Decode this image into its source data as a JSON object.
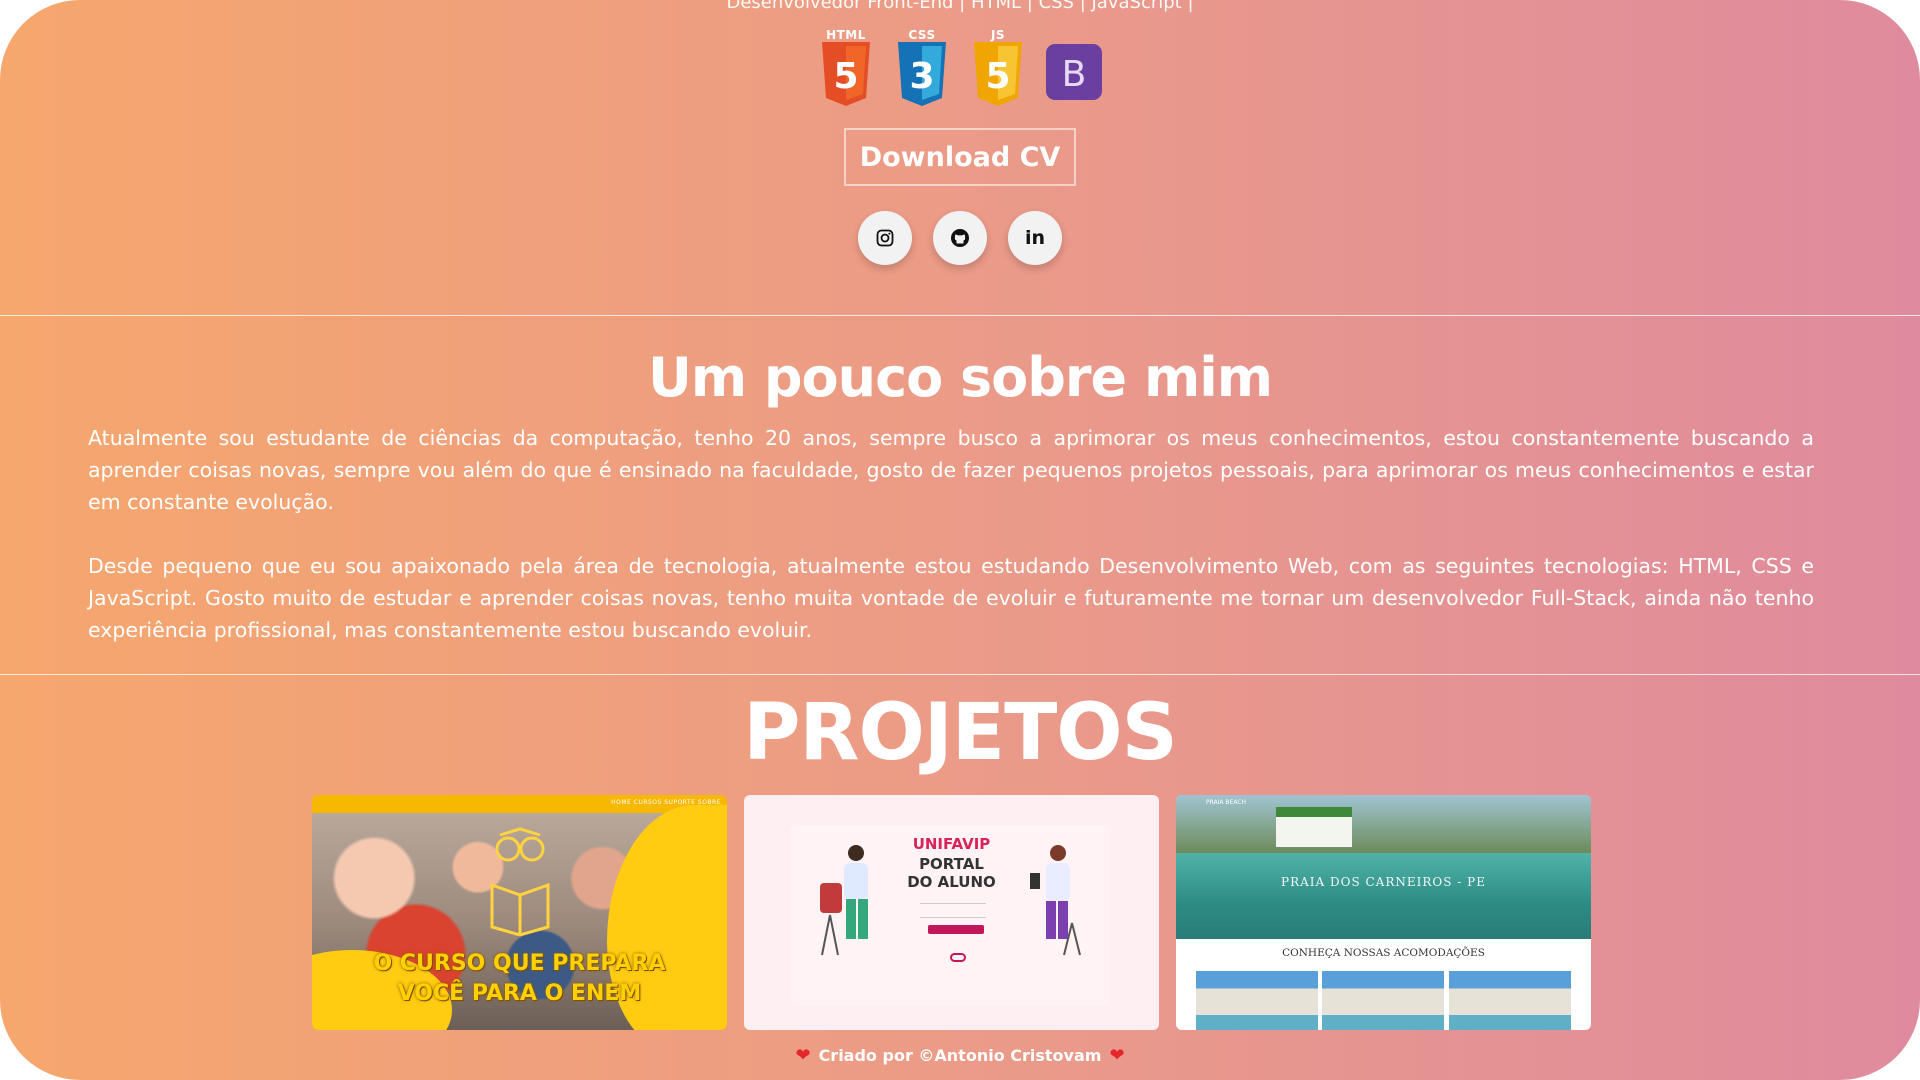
{
  "header": {
    "subtitle": "Desenvolvedor Front-End | HTML | CSS | JavaScript |"
  },
  "tech_icons": [
    {
      "icon": "html5-icon",
      "label": "HTML",
      "glyph": "5",
      "color": "#e44d26"
    },
    {
      "icon": "css3-icon",
      "label": "CSS",
      "glyph": "3",
      "color": "#1572b6"
    },
    {
      "icon": "javascript-icon",
      "label": "JS",
      "glyph": "5",
      "color": "#f5b800"
    },
    {
      "icon": "bootstrap-icon",
      "label": "",
      "glyph": "B",
      "color": "#6b3fa0"
    }
  ],
  "download_label": "Download CV",
  "social": [
    {
      "icon": "instagram-icon"
    },
    {
      "icon": "github-icon"
    },
    {
      "icon": "linkedin-icon",
      "text": "in"
    }
  ],
  "about": {
    "title": "Um pouco sobre mim",
    "paragraph1": "Atualmente sou estudante de ciências da computação, tenho 20 anos, sempre busco a aprimorar os meus conhecimentos, estou constantemente buscando a aprender coisas novas, sempre vou além do que é ensinado na faculdade, gosto de fazer pequenos projetos pessoais, para aprimorar os meus conhecimentos e estar em constante evolução.",
    "paragraph2": "Desde pequeno que eu sou apaixonado pela área de tecnologia, atualmente estou estudando Desenvolvimento Web, com as seguintes tecnologias: HTML, CSS e JavaScript. Gosto muito de estudar e aprender coisas novas, tenho muita vontade de evoluir e futuramente me tornar um desenvolvedor Full-Stack, ainda não tenho experiência profissional, mas constantemente estou buscando evoluir."
  },
  "projects": {
    "title": "PROJETOS",
    "items": [
      {
        "name": "enem-course",
        "nav": "HOME  CURSOS  SUPORTE  SOBRE",
        "headline_line1": "O CURSO QUE PREPARA",
        "headline_line2": "VOCÊ PARA O ENEM"
      },
      {
        "name": "portal-aluno",
        "brand": "UNIFAVIP",
        "line1": "PORTAL",
        "line2": "DO ALUNO"
      },
      {
        "name": "praia-carneiros",
        "brand": "PRAIA BEACH",
        "title": "PRAIA DOS CARNEIROS - PE",
        "section": "CONHEÇA NOSSAS ACOMODAÇÕES"
      }
    ]
  },
  "footer": {
    "text": "Criado por ©Antonio Cristovam"
  },
  "colors": {
    "gradient_start": "#f6a76d",
    "gradient_end": "#df8b9e",
    "heart": "#e5262b"
  }
}
